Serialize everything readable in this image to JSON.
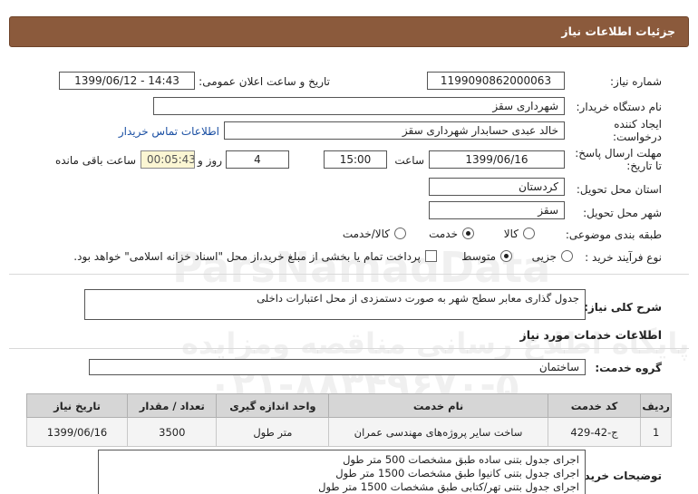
{
  "page": {
    "title": "جزئیات اطلاعات نیاز"
  },
  "fields": {
    "need_number": {
      "label": "شماره نیاز:",
      "value": "1199090862000063"
    },
    "announce_datetime": {
      "label": "تاریخ و ساعت اعلان عمومی:",
      "value": "1399/06/12 - 14:43"
    },
    "buyer_org": {
      "label": "نام دستگاه خریدار:",
      "value": "شهرداری سقز"
    },
    "creator": {
      "label_line1": "ایجاد کننده",
      "label_line2": "درخواست:",
      "value": "خالد عبدی حسابدار شهرداری سقز",
      "contact_link": "اطلاعات تماس خریدار"
    },
    "deadline": {
      "label_line1": "مهلت ارسال پاسخ:",
      "label_line2": "تا تاریخ:",
      "date": "1399/06/16",
      "time_label": "ساعت",
      "time": "15:00",
      "days": "4",
      "days_label": "روز و",
      "remaining": "00:05:43",
      "remaining_label": "ساعت باقی مانده"
    },
    "province": {
      "label": "استان محل تحویل:",
      "value": "کردستان"
    },
    "city": {
      "label": "شهر محل تحویل:",
      "value": "سقز"
    },
    "category": {
      "label": "طبقه بندی موضوعی:",
      "options": [
        "کالا",
        "خدمت",
        "کالا/خدمت"
      ],
      "selected": "خدمت"
    },
    "purchase_type": {
      "label": "نوع فرآیند خرید :",
      "options": [
        "جزیی",
        "متوسط"
      ],
      "selected": "متوسط",
      "payment_note": "پرداخت تمام یا بخشی از مبلغ خرید،از محل \"اسناد خزانه اسلامی\" خواهد بود."
    }
  },
  "summary": {
    "label": "شرح کلی نیاز:",
    "value": "جدول گذاری معابر سطح شهر  به صورت دستمزدی  از محل اعتبارات داخلی"
  },
  "services_section": {
    "title": "اطلاعات خدمات مورد نیاز",
    "group_label": "گروه خدمت:",
    "group_value": "ساختمان"
  },
  "table": {
    "headers": [
      "ردیف",
      "کد خدمت",
      "نام خدمت",
      "واحد اندازه گیری",
      "تعداد / مقدار",
      "تاریخ نیاز"
    ],
    "rows": [
      [
        "1",
        "ج-42-429",
        "ساخت سایر پروژه‌های مهندسی عمران",
        "متر طول",
        "3500",
        "1399/06/16"
      ]
    ]
  },
  "buyer_notes": {
    "label": "توضیحات خریدار:",
    "lines": [
      "اجرای جدول بتنی ساده طبق مشخصات   500 متر طول",
      "اجرای جدول بتنی کانیوا طبق مشخصات   1500 متر طول",
      "اجرای جدول بتنی تهر/کتابی طبق مشخصات   1500 متر طول"
    ]
  },
  "watermark": {
    "lines": [
      "ParsNamadData",
      "پایگاه اطلاع رسانی مناقصه ومزایده",
      "۰۲۱-۸۸۳۴۹۶۷۰-۵"
    ]
  }
}
